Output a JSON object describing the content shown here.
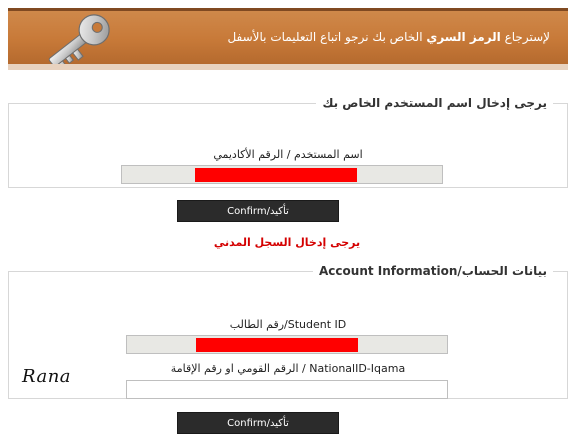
{
  "header": {
    "title_prefix": "لإسترجاع ",
    "title_bold": "الرمز السري",
    "title_suffix": " الخاص بك نرجو اتباع التعليمات بالأسفل"
  },
  "section1": {
    "legend": "يرجى إدخال اسم المستخدم الخاص بك",
    "field_label": "اسم المستخدم / الرقم الأكاديمي",
    "confirm_label": "Confirm/تأكيد"
  },
  "error": {
    "message": "يرجى إدخال السجل المدني"
  },
  "section2": {
    "legend": "بيانات الحساب/Account Information",
    "student_id_label": "رقم الطالب/Student ID",
    "national_id_label": "الرقم القومي او رقم الإقامة / NationalID-Iqama",
    "confirm_label": "Confirm/تأكيد"
  },
  "signature": "Rana"
}
